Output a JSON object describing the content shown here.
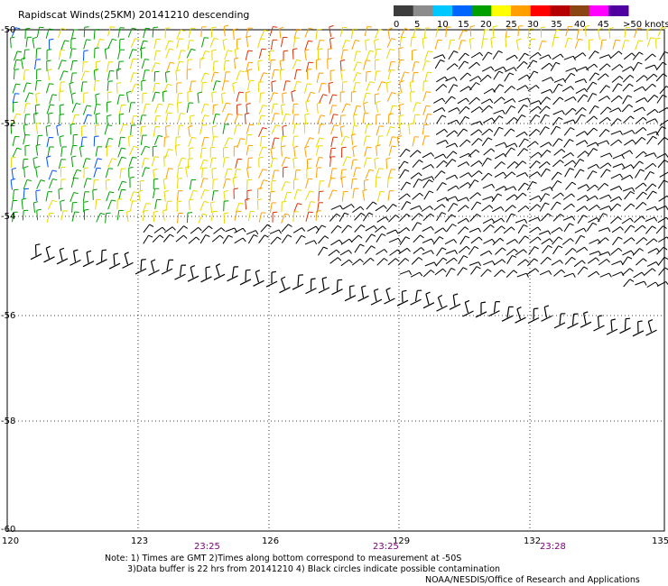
{
  "title": "Rapidscat Winds(25KM) 20141210 descending",
  "legend": {
    "labels": [
      "0",
      "5",
      "10",
      "15",
      "20",
      "25",
      "30",
      "35",
      "40",
      "45",
      ">50 knots"
    ],
    "colors": [
      "#3c3c3c",
      "#8c8c8c",
      "#00c8ff",
      "#0064ff",
      "#00a000",
      "#ffff00",
      "#ffa000",
      "#ff0000",
      "#b40000",
      "#8b4513",
      "#ff00ff",
      "#5000a0"
    ]
  },
  "axes": {
    "lat_labels": [
      "-50",
      "-52",
      "-54",
      "-56",
      "-58",
      "-60"
    ],
    "lon_labels": [
      "120",
      "123",
      "126",
      "129",
      "132",
      "135"
    ]
  },
  "times": [
    "23:25",
    "23:25",
    "23:28"
  ],
  "notes": {
    "line1": "Note: 1) Times are GMT 2)Times along bottom correspond to measurement at -50S",
    "line2": "3)Data buffer is 22 hrs from 20141210 4) Black circles indicate possible contamination",
    "credit": "NOAA/NESDIS/Office of Research and Applications"
  },
  "palette": {
    "green": "#00a000",
    "yellow": "#e8d800",
    "orange": "#ffa000",
    "red": "#e03000",
    "blue": "#0050ff",
    "black": "#000000",
    "purple_time": "#800080"
  }
}
